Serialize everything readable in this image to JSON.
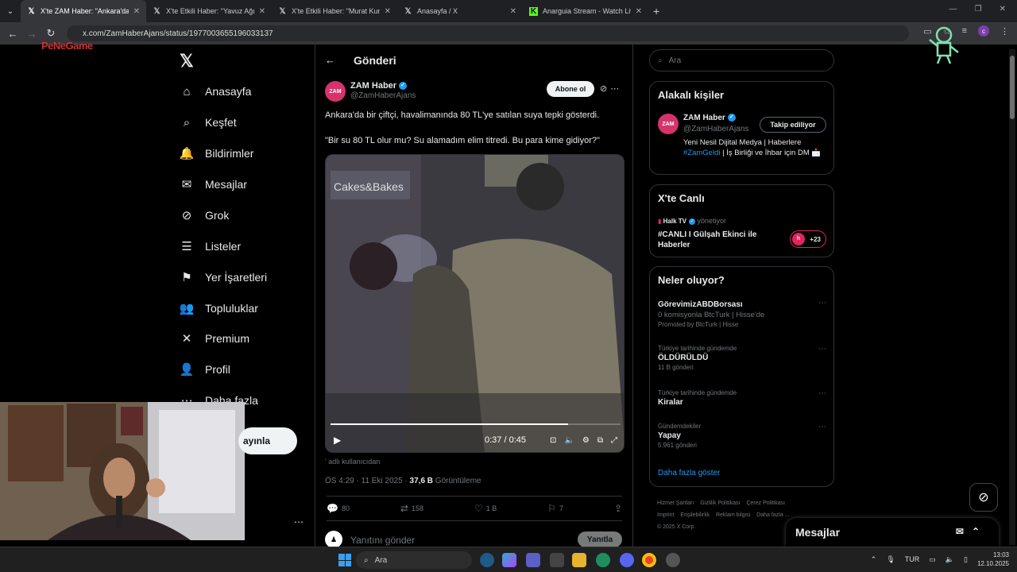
{
  "browser": {
    "tabs": [
      {
        "title": "X'te ZAM Haber: \"Ankara'da bi",
        "active": true,
        "icon": "x-icon"
      },
      {
        "title": "X'te Etkili Haber: \"Yavuz Ağıralio",
        "active": false,
        "icon": "x-icon"
      },
      {
        "title": "X'te Etkili Haber: \"Murat Kurum",
        "active": false,
        "icon": "x-icon"
      },
      {
        "title": "Anasayfa / X",
        "active": false,
        "icon": "x-icon"
      },
      {
        "title": "Anarguia Stream - Watch Live o",
        "active": false,
        "icon": "kick-icon"
      }
    ],
    "url": "x.com/ZamHaberAjans/status/1977003655196033137",
    "profile_initial": "c"
  },
  "overlay_logo": "PeNeGame",
  "leftnav": {
    "items": [
      {
        "label": "Anasayfa",
        "icon": "home-icon",
        "glyph": "⌂"
      },
      {
        "label": "Keşfet",
        "icon": "search-icon",
        "glyph": "⌕"
      },
      {
        "label": "Bildirimler",
        "icon": "bell-icon",
        "glyph": "🔔"
      },
      {
        "label": "Mesajlar",
        "icon": "mail-icon",
        "glyph": "✉"
      },
      {
        "label": "Grok",
        "icon": "grok-icon",
        "glyph": "⊘"
      },
      {
        "label": "Listeler",
        "icon": "list-icon",
        "glyph": "☰"
      },
      {
        "label": "Yer İşaretleri",
        "icon": "bookmark-icon",
        "glyph": "⚑"
      },
      {
        "label": "Topluluklar",
        "icon": "communities-icon",
        "glyph": "👥"
      },
      {
        "label": "Premium",
        "icon": "x-premium-icon",
        "glyph": "✕"
      },
      {
        "label": "Profil",
        "icon": "profile-icon",
        "glyph": "👤"
      },
      {
        "label": "Daha fazla",
        "icon": "more-icon",
        "glyph": "⋯"
      }
    ],
    "post_button_partial": "ayınla"
  },
  "post": {
    "header_title": "Gönderi",
    "author_name": "ZAM Haber",
    "author_handle": "@ZamHaberAjans",
    "avatar_text": "ZAM",
    "subscribe_label": "Abone ol",
    "text1": "Ankara'da bir çiftçi, havalimanında 80 TL'ye satılan suya tepki gösterdi.",
    "text2": "\"Bir su 80 TL olur mu? Su alamadım elim titredi. Bu para kime gidiyor?\"",
    "video": {
      "time": "0:37 / 0:45",
      "progress": 0.82
    },
    "video_caption": "' adlı kullanıcıdan",
    "time": "ÖS 4:29 · 11 Eki 2025 · ",
    "views_count": "37,6 B",
    "views_label": " Görüntüleme",
    "actions": {
      "replies": "80",
      "reposts": "158",
      "likes": "1 B",
      "bookmarks": "7"
    },
    "reply_placeholder": "Yanıtını gönder",
    "reply_button": "Yanıtla"
  },
  "sidebar": {
    "search_placeholder": "Ara",
    "related": {
      "title": "Alakalı kişiler",
      "name": "ZAM Haber",
      "handle": "@ZamHaberAjans",
      "follow_label": "Takip ediliyor",
      "bio_part1": "Yeni Nesil Dijital Medya | Haberlere ",
      "bio_hashtag": "#ZamGeldi",
      "bio_part2": " | İş Birliği ve İhbar için DM 📩"
    },
    "live": {
      "title": "X'te Canlı",
      "host": "Halk TV",
      "host_suffix": " yönetiyor",
      "show_title": "#CANLI I Gülşah Ekinci ile Haberler",
      "listeners": "+23"
    },
    "trends": {
      "title": "Neler oluyor?",
      "items": [
        {
          "context": "",
          "name": "GörevimizABDBorsası",
          "sub": "0 komisyonla BtcTurk | Hisse'de",
          "meta": "Promoted by BtcTurk | Hisse"
        },
        {
          "context": "Türkiye tarihinde gündemde",
          "name": "ÖLDÜRÜLDÜ",
          "sub": "",
          "meta": "11 B gönderi"
        },
        {
          "context": "Türkiye tarihinde gündemde",
          "name": "Kiralar",
          "sub": "",
          "meta": ""
        },
        {
          "context": "Gündemdekiler",
          "name": "Yapay",
          "sub": "",
          "meta": "5.961 gönderi"
        }
      ],
      "show_more": "Daha fazla göster"
    },
    "footer": [
      "Hizmet Şartları",
      "Gizlilik Politikası",
      "Çerez Politikası",
      "Imprint",
      "Erişilebilirlik",
      "Reklam bilgisi",
      "Daha fazla ...",
      "© 2025 X Corp."
    ]
  },
  "messages_bar": {
    "label": "Mesajlar"
  },
  "taskbar": {
    "search_placeholder": "Ara",
    "lang": "TUR",
    "time": "13:03",
    "date": "12.10.2025"
  },
  "colors": {
    "accent": "#1d9bf0",
    "bg": "#000000",
    "border": "#2f3336",
    "brand_zam": "#d6336c"
  }
}
